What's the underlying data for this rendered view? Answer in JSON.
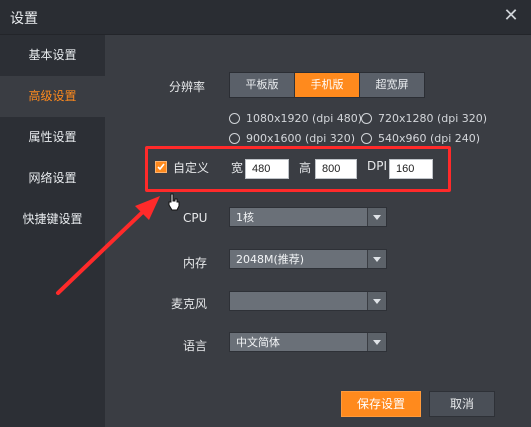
{
  "window": {
    "title": "设置"
  },
  "sidebar": {
    "items": [
      {
        "label": "基本设置"
      },
      {
        "label": "高级设置"
      },
      {
        "label": "属性设置"
      },
      {
        "label": "网络设置"
      },
      {
        "label": "快捷键设置"
      }
    ]
  },
  "resolution": {
    "label": "分辨率",
    "modes": [
      {
        "label": "平板版"
      },
      {
        "label": "手机版"
      },
      {
        "label": "超宽屏"
      }
    ],
    "presets": [
      {
        "label": "1080x1920 (dpi 480)"
      },
      {
        "label": "720x1280 (dpi 320)"
      },
      {
        "label": "900x1600 (dpi 320)"
      },
      {
        "label": "540x960 (dpi 240)"
      }
    ],
    "custom": {
      "label": "自定义",
      "checked": true,
      "width_label": "宽",
      "width_value": "480",
      "height_label": "高",
      "height_value": "800",
      "dpi_label": "DPI",
      "dpi_value": "160"
    }
  },
  "fields": {
    "cpu": {
      "label": "CPU",
      "value": "1核"
    },
    "memory": {
      "label": "内存",
      "value": "2048M(推荐)"
    },
    "mic": {
      "label": "麦克风",
      "value": ""
    },
    "language": {
      "label": "语言",
      "value": "中文简体"
    }
  },
  "footer": {
    "save_label": "保存设置",
    "cancel_label": "取消"
  },
  "colors": {
    "accent": "#ff8a1d",
    "annotation": "#ff2a2a"
  }
}
